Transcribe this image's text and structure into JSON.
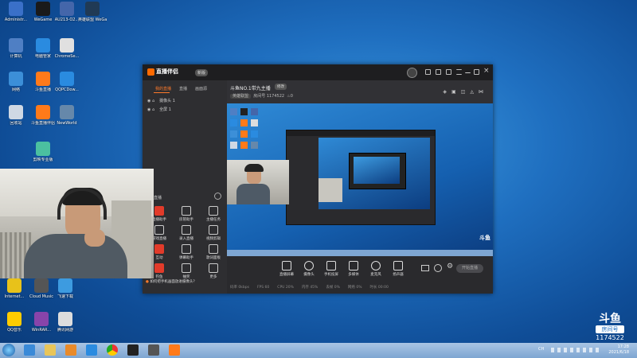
{
  "desktop": {
    "icons_top": [
      {
        "label": "Administr...",
        "color": "#3a70c8"
      },
      {
        "label": "WeGame",
        "color": "#1a1a1a"
      },
      {
        "label": "AU213-O2...",
        "color": "#4466aa"
      },
      {
        "label": "英雄联盟 WeGame版",
        "color": "#203a55"
      },
      {
        "label": "计算机",
        "color": "#4f7fc4"
      },
      {
        "label": "电脑管家",
        "color": "#2a8be0"
      },
      {
        "label": "ChromeSe...",
        "color": "#e0e0e0"
      },
      {
        "label": "网络",
        "color": "#3c8fd8"
      },
      {
        "label": "斗鱼直播",
        "color": "#ff7a1a"
      },
      {
        "label": "QQPCDow...",
        "color": "#2a8be0"
      },
      {
        "label": "回收站",
        "color": "#cfd8e4"
      },
      {
        "label": "斗鱼直播伴侣",
        "color": "#ff7a1a"
      },
      {
        "label": "NewWorld",
        "color": "#6688aa"
      },
      {
        "label": "剪映专业版",
        "color": "#4bc0a0"
      }
    ],
    "icons_bottom": [
      {
        "label": "Internet...",
        "color": "#e8c21a"
      },
      {
        "label": "Cloud Music",
        "color": "#555555"
      },
      {
        "label": "飞速下载",
        "color": "#3d9be0"
      },
      {
        "label": "QQ音乐",
        "color": "#ffcc00"
      },
      {
        "label": "WinRAR...",
        "color": "#8844aa"
      },
      {
        "label": "腾讯网游",
        "color": "#dddddd"
      }
    ]
  },
  "app": {
    "title": "直播伴侣",
    "version": "新版",
    "tabs": [
      "我的直播",
      "直播",
      "画面源"
    ],
    "scenes": [
      "摄像头 1",
      "全屏 1"
    ],
    "section_label": "直播",
    "tools": [
      {
        "label": "直播助手",
        "icon": "grid-icon"
      },
      {
        "label": "房管助手",
        "icon": "user-icon"
      },
      {
        "label": "主播任务",
        "icon": "task-icon"
      },
      {
        "label": "游戏直播",
        "icon": "gamepad-icon"
      },
      {
        "label": "录入直播",
        "icon": "download-icon"
      },
      {
        "label": "视频剪辑",
        "icon": "edit-icon"
      },
      {
        "label": "互动",
        "icon": "chat-icon"
      },
      {
        "label": "弹幕助手",
        "icon": "danmaku-icon"
      },
      {
        "label": "歌词面板",
        "icon": "music-icon"
      },
      {
        "label": "钓鱼",
        "icon": "fish-icon"
      },
      {
        "label": "抽奖",
        "icon": "gift-icon"
      },
      {
        "label": "更多",
        "icon": "more-icon"
      }
    ],
    "notice": "如何把手机画面放进摄像头？",
    "room": {
      "title": "斗鱼NO.1带九主播",
      "tag": "修改",
      "category": "英雄联盟",
      "room_label": "房间号",
      "room_id": "1174522",
      "hot": "0"
    },
    "bottom_buttons": [
      {
        "label": "直播屏幕",
        "icon": "screen-icon"
      },
      {
        "label": "摄像头",
        "icon": "camera-icon"
      },
      {
        "label": "手机投屏",
        "icon": "phone-icon"
      },
      {
        "label": "多媒体",
        "icon": "media-icon"
      },
      {
        "label": "麦克风",
        "icon": "mic-icon"
      },
      {
        "label": "扬声器",
        "icon": "speaker-icon"
      }
    ],
    "start_button": "开始直播",
    "stats": [
      "码率 0kbps",
      "FPS 60",
      "CPU 20%",
      "内存 45%",
      "丢帧 0%",
      "网络 0%",
      "时长 00:00"
    ]
  },
  "taskbar": {
    "time": "17:28",
    "date": "2021/6/18",
    "lang": "CH"
  },
  "watermark": {
    "brand": "斗鱼",
    "label": "房间号",
    "room_id": "1174522"
  }
}
